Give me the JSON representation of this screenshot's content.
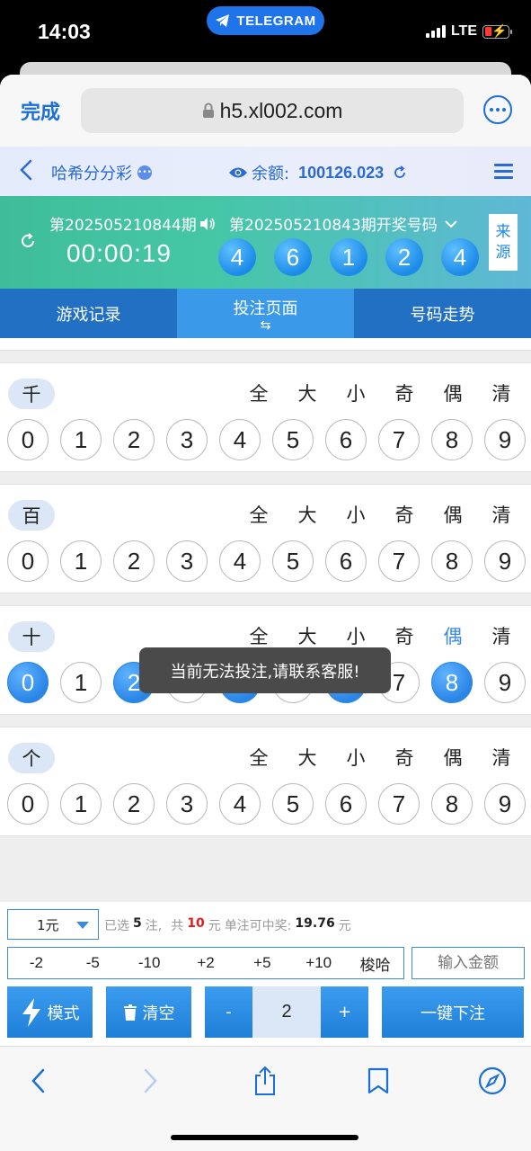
{
  "status_bar": {
    "time": "14:03",
    "pill_label": "TELEGRAM",
    "network": "LTE"
  },
  "browser": {
    "done_label": "完成",
    "url": "h5.xl002.com"
  },
  "header": {
    "back_icon": "chevron-left-icon",
    "game_name": "哈希分分彩",
    "balance_label": "余额:",
    "balance_value": "100126.023"
  },
  "draw": {
    "current_period": "第202505210844期",
    "countdown": "00:00:19",
    "prev_period_label": "第202505210843期开奖号码",
    "prev_numbers": [
      "4",
      "6",
      "1",
      "2",
      "4"
    ],
    "source_chars": [
      "来",
      "源"
    ],
    "ball_color": "#1c8ae8"
  },
  "tabs": [
    {
      "label": "游戏记录",
      "active": false
    },
    {
      "label": "投注页面",
      "active": true,
      "sub": "⇆"
    },
    {
      "label": "号码走势",
      "active": false
    }
  ],
  "quick_labels": [
    "全",
    "大",
    "小",
    "奇",
    "偶",
    "清"
  ],
  "digits": [
    "0",
    "1",
    "2",
    "3",
    "4",
    "5",
    "6",
    "7",
    "8",
    "9"
  ],
  "positions": [
    {
      "label": "千",
      "selected": [],
      "quick_selected": ""
    },
    {
      "label": "百",
      "selected": [],
      "quick_selected": ""
    },
    {
      "label": "十",
      "selected": [
        "0",
        "2",
        "4",
        "6",
        "8"
      ],
      "quick_selected": "偶"
    },
    {
      "label": "个",
      "selected": [],
      "quick_selected": ""
    }
  ],
  "toast": "当前无法投注,请联系客服!",
  "bet": {
    "unit": "1元",
    "selected_prefix": "已选",
    "selected_count": "5",
    "count_unit": "注,",
    "total_prefix": "共",
    "total_amount": "10",
    "total_unit": "元",
    "win_label": "单注可中奖:",
    "win_amount": "19.76",
    "win_unit": "元",
    "quick_amounts": [
      "-2",
      "-5",
      "-10",
      "+2",
      "+5",
      "+10",
      "梭哈"
    ],
    "amount_placeholder": "输入金额",
    "mode_label": "模式",
    "clear_label": "清空",
    "minus_label": "-",
    "multiplier": "2",
    "plus_label": "+",
    "submit_label": "一键下注",
    "accent_color": "#3a8ae0"
  }
}
